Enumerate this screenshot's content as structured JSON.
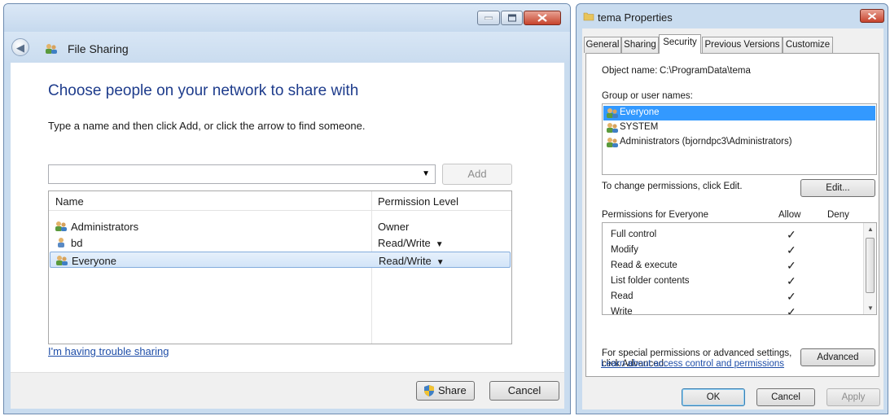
{
  "file_sharing": {
    "title": "File Sharing",
    "heading": "Choose people on your network to share with",
    "instruction": "Type a name and then click Add, or click the arrow to find someone.",
    "name_input_value": "",
    "add_label": "Add",
    "columns": [
      "Name",
      "Permission Level"
    ],
    "people": [
      {
        "name": "Administrators",
        "level": "Owner",
        "has_dropdown": false,
        "icon": "group-icon",
        "selected": false
      },
      {
        "name": "bd",
        "level": "Read/Write",
        "has_dropdown": true,
        "icon": "user-icon",
        "selected": false
      },
      {
        "name": "Everyone",
        "level": "Read/Write",
        "has_dropdown": true,
        "icon": "group-icon",
        "selected": true
      }
    ],
    "trouble_link": "I'm having trouble sharing",
    "share_label": "Share",
    "cancel_label": "Cancel"
  },
  "properties": {
    "title": "tema Properties",
    "tabs": [
      {
        "label": "General",
        "active": false
      },
      {
        "label": "Sharing",
        "active": false
      },
      {
        "label": "Security",
        "active": true
      },
      {
        "label": "Previous Versions",
        "active": false
      },
      {
        "label": "Customize",
        "active": false
      }
    ],
    "object_name_label": "Object name:",
    "object_name_value": "C:\\ProgramData\\tema",
    "group_label": "Group or user names:",
    "users": [
      {
        "name": "Everyone",
        "selected": true
      },
      {
        "name": "SYSTEM",
        "selected": false
      },
      {
        "name": "Administrators (bjorndpc3\\Administrators)",
        "selected": false
      }
    ],
    "change_text": "To change permissions, click Edit.",
    "edit_label": "Edit...",
    "perm_header": "Permissions for Everyone",
    "allow_label": "Allow",
    "deny_label": "Deny",
    "permissions": [
      {
        "name": "Full control",
        "allow": true
      },
      {
        "name": "Modify",
        "allow": true
      },
      {
        "name": "Read & execute",
        "allow": true
      },
      {
        "name": "List folder contents",
        "allow": true
      },
      {
        "name": "Read",
        "allow": true
      },
      {
        "name": "Write",
        "allow": true
      }
    ],
    "check_glyph": "✓",
    "special_text_1": "For special permissions or advanced settings,",
    "special_text_2": "click Advanced.",
    "advanced_label": "Advanced",
    "learn_link": "Learn about access control and permissions",
    "ok_label": "OK",
    "cancel_label": "Cancel",
    "apply_label": "Apply"
  }
}
